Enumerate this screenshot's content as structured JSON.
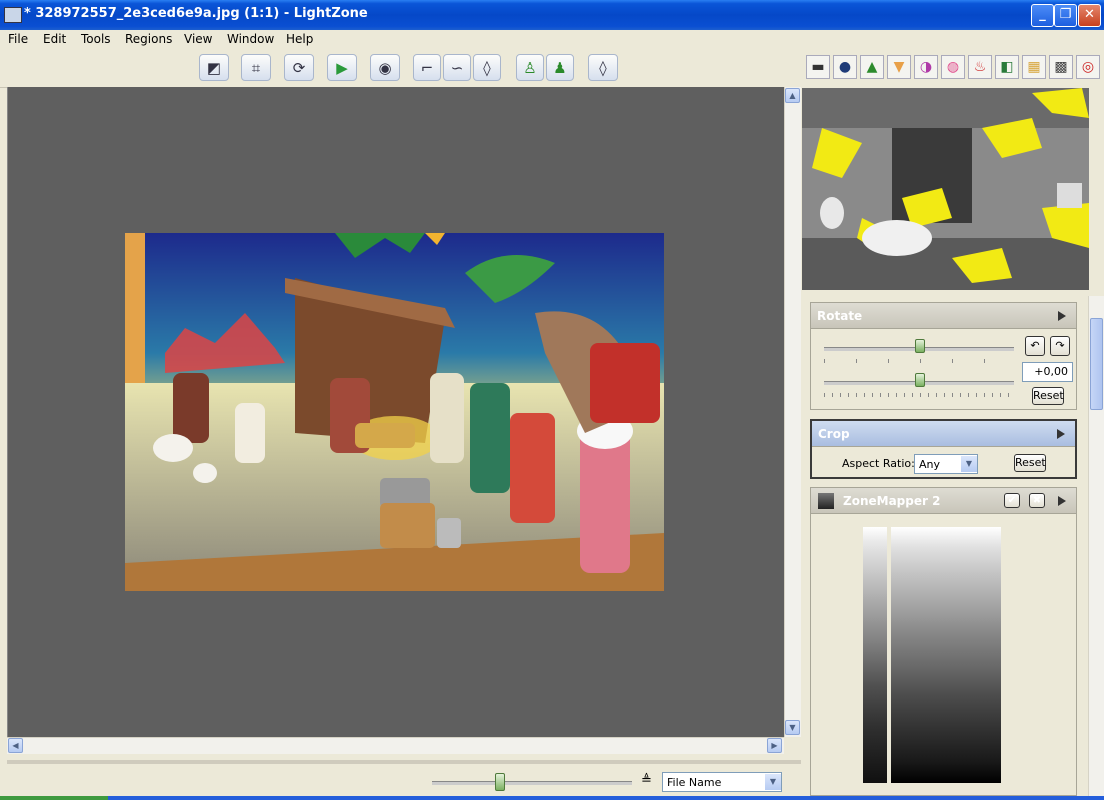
{
  "window": {
    "title": "* 328972557_2e3ced6e9a.jpg (1:1) - LightZone",
    "minimize": "_",
    "restore": "❐",
    "close": "✕"
  },
  "menu": [
    "File",
    "Edit",
    "Tools",
    "Regions",
    "View",
    "Window",
    "Help"
  ],
  "toolbar_left": [
    {
      "name": "compare",
      "glyph": "◩"
    },
    {
      "name": "crop",
      "glyph": "⌗"
    },
    {
      "name": "rotate",
      "glyph": "⟳"
    },
    {
      "name": "send",
      "glyph": "▶"
    },
    {
      "name": "preview",
      "glyph": "◉"
    },
    {
      "name": "region-polygon",
      "glyph": "⌐"
    },
    {
      "name": "region-spline",
      "glyph": "∽"
    },
    {
      "name": "region-drop",
      "glyph": "◊"
    },
    {
      "name": "clone",
      "glyph": "♙"
    },
    {
      "name": "heal",
      "glyph": "♟"
    },
    {
      "name": "zone-drop",
      "glyph": "◊"
    }
  ],
  "toolbar_right": [
    {
      "name": "zone-mapper",
      "glyph": "▬",
      "color": "#333"
    },
    {
      "name": "sharpen",
      "glyph": "●",
      "color": "#1f3c78"
    },
    {
      "name": "noise",
      "glyph": "▲",
      "color": "#2d8b2d"
    },
    {
      "name": "blur",
      "glyph": "▼",
      "color": "#e8a048"
    },
    {
      "name": "color-balance",
      "glyph": "◑",
      "color": "#b03aa8"
    },
    {
      "name": "hue-saturation",
      "glyph": "◍",
      "color": "#e04c8c"
    },
    {
      "name": "white-balance",
      "glyph": "♨",
      "color": "#cc2222"
    },
    {
      "name": "channel-mixer",
      "glyph": "◧",
      "color": "#2a7a3a"
    },
    {
      "name": "relight",
      "glyph": "▦",
      "color": "#d7a63c"
    },
    {
      "name": "grid",
      "glyph": "▩",
      "color": "#444"
    },
    {
      "name": "red-eye",
      "glyph": "◎",
      "color": "#cc2222"
    }
  ],
  "rotate": {
    "title": "Rotate",
    "value": "+0,00",
    "reset": "Reset",
    "slider_fraction": 0.5
  },
  "crop": {
    "title": "Crop",
    "aspect_label": "Aspect Ratio:",
    "aspect_value": "Any",
    "reset": "Reset"
  },
  "zonemapper": {
    "title": "ZoneMapper 2"
  },
  "bottom": {
    "sort_value": "File Name"
  }
}
